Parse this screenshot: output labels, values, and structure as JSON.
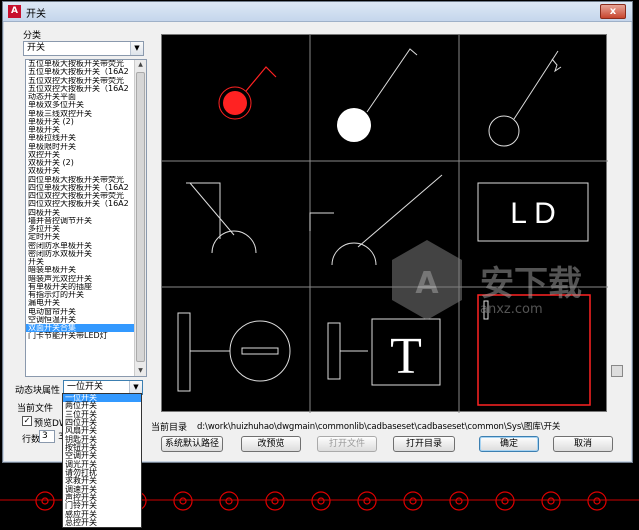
{
  "window": {
    "title": "开关",
    "app_icon": "A",
    "close": "x"
  },
  "category_label": "分类",
  "category_select": {
    "value": "开关"
  },
  "block_list": {
    "items": [
      "五位单极大按板开关带荧光",
      "五位单极大按板开关（16A2",
      "五位双控大按板开关带荧光",
      "五位双控大按板开关（16A2",
      "动态开关平面",
      "单极双多位开关",
      "单极三线双控开关",
      "单极开关 (2)",
      "单极开关",
      "单极拉线开关",
      "单极限时开关",
      "双控开关",
      "双极开关 (2)",
      "双极开关",
      "四位单极大按板开关带荧光",
      "四位单极大按板开关（16A2",
      "四位双控大按板开关带荧光",
      "四位双控大按板开关（16A2",
      "四极开关",
      "墙并音控调节开关",
      "多拉开关",
      "定时开关",
      "密闭防水单极开关",
      "密闭防水双极开关",
      "开关",
      "暗装单极开关",
      "暗装声光双控开关",
      "有单极开关的插座",
      "有指示灯的开关",
      "漏电开关",
      "电动窗帘开关",
      "空调恒温开关",
      "双面开关合集",
      "门卡节能开关带LED灯"
    ],
    "selected_index": 32
  },
  "dynamic_attr_label": "动态块属性",
  "dynamic_attr_select": {
    "value": "一位开关"
  },
  "dynamic_attr_options": [
    "一位开关",
    "两位开关",
    "三位开关",
    "四位开关",
    "风扇开关",
    "钥匙开关",
    "按钮开关",
    "空调开关",
    "调光开关",
    "请勿打扰",
    "求救开关",
    "调速开关",
    "声控开关",
    "门铃开关",
    "感应开关",
    "总控开关"
  ],
  "dynamic_attr_highlighted": 0,
  "current_file_label": "当前文件",
  "preview_checkbox": {
    "label": "预览DWG",
    "checked": true
  },
  "rows": {
    "label": "行数",
    "value": "3",
    "extra": "3"
  },
  "path": {
    "label": "当前目录",
    "value": "d:\\work\\huizhuhao\\dwgmain\\commonlib\\cadbaseset\\cadbaseset\\common\\Sys\\图库\\开关"
  },
  "buttons": {
    "default_path": "系统默认路径",
    "change_preview": "改预览",
    "open_file": "打开文件",
    "open_dir": "打开目录",
    "ok": "确定",
    "cancel": "取消"
  },
  "preview_tiles": [
    {
      "label": ""
    },
    {
      "label": ""
    },
    {
      "label": ""
    },
    {
      "label": ""
    },
    {
      "label": ""
    },
    {
      "label": "L D"
    },
    {
      "label": ""
    },
    {
      "label": "T"
    },
    {
      "label": ""
    }
  ],
  "watermark": {
    "cn": "安下载",
    "en": "anxz.com"
  },
  "colors": {
    "accent_red": "#ff2222",
    "selection": "#3399ff",
    "grid_line": "#888888"
  }
}
